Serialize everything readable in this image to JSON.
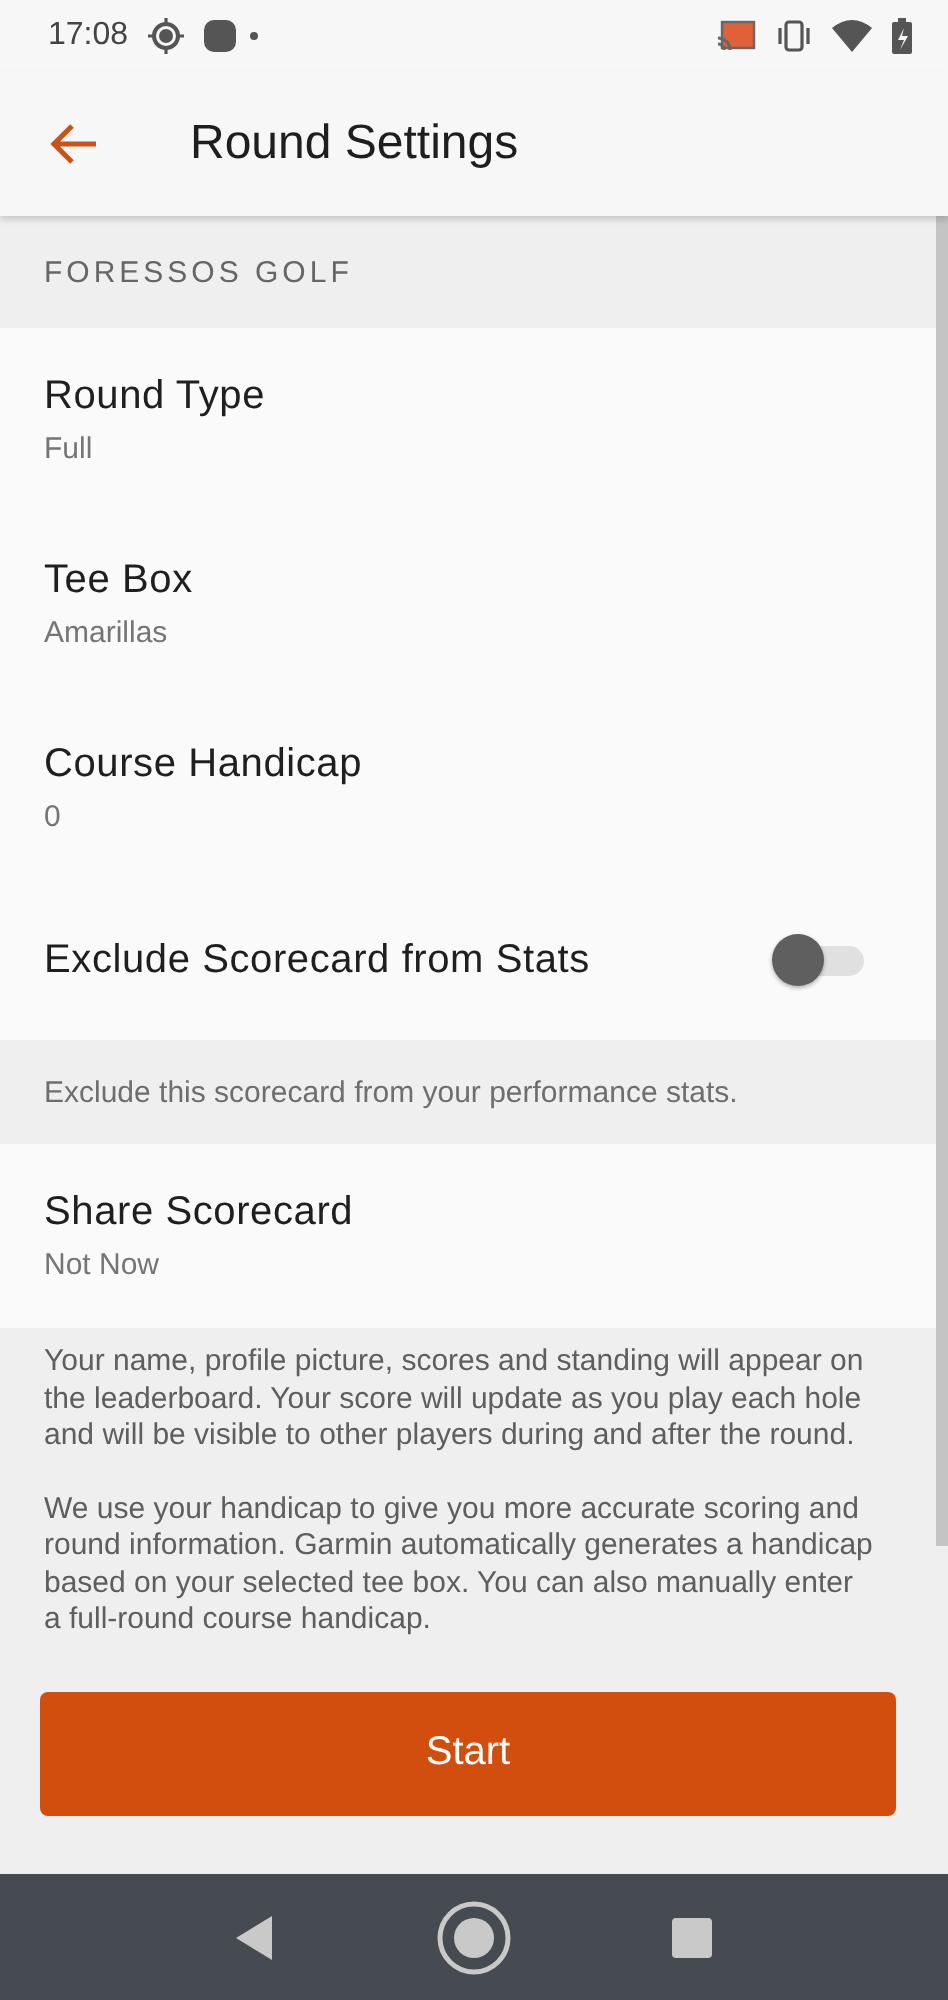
{
  "status_bar": {
    "time": "17:08"
  },
  "app_bar": {
    "title": "Round Settings"
  },
  "section": {
    "header": "FORESSOS GOLF"
  },
  "settings": [
    {
      "kind": "value",
      "label": "Round Type",
      "value": "Full"
    },
    {
      "kind": "value",
      "label": "Tee Box",
      "value": "Amarillas"
    },
    {
      "kind": "value",
      "label": "Course Handicap",
      "value": "0"
    },
    {
      "kind": "toggle",
      "label": "Exclude Scorecard from Stats",
      "on": false,
      "note": "Exclude this scorecard from your performance stats."
    },
    {
      "kind": "value",
      "label": "Share Scorecard",
      "value": "Not Now"
    }
  ],
  "info": [
    "Your name, profile picture, scores and standing will appear on the leaderboard. Your score will update as you play each hole and will be visible to other players during and after the round.",
    "We use your handicap to give you more accurate scoring and round information. Garmin automatically generates a handicap based on your selected tee box. You can also manually enter a full-round course handicap."
  ],
  "start_button": "Start"
}
